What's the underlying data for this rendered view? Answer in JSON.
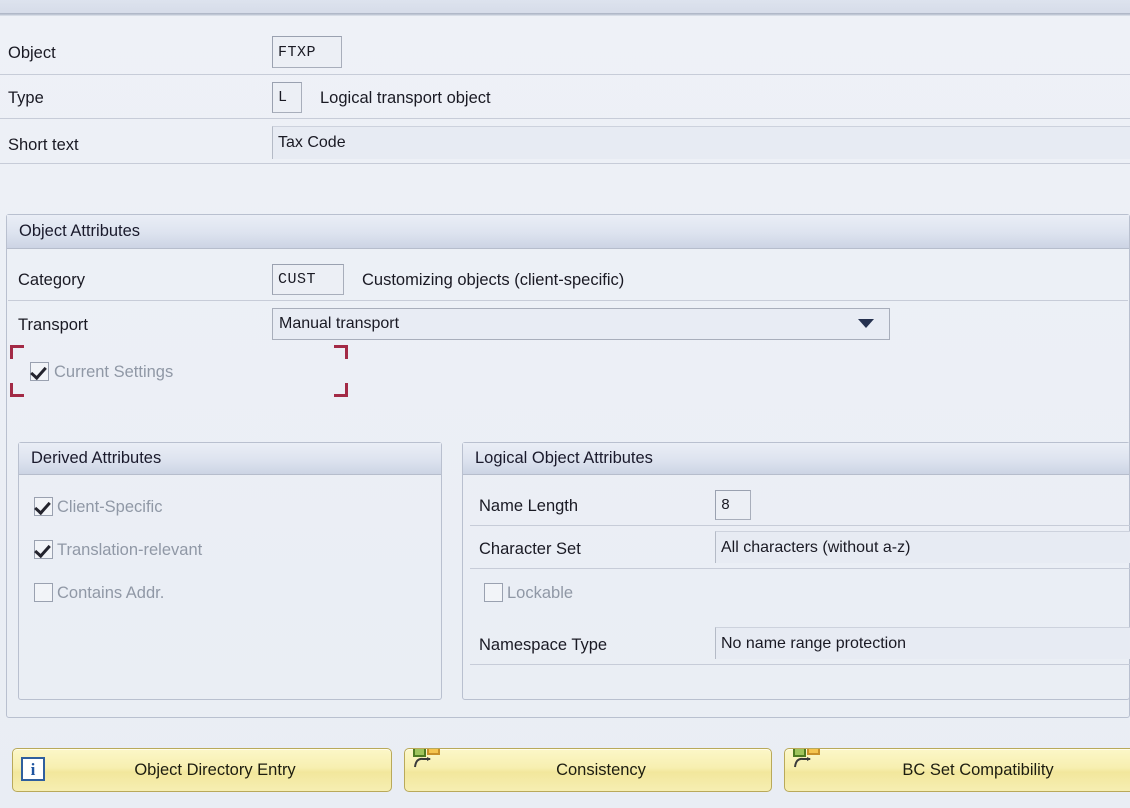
{
  "header": {
    "fields": [
      {
        "label": "Object",
        "value": "FTXP",
        "desc": ""
      },
      {
        "label": "Type",
        "value": "L",
        "desc": "Logical transport object"
      },
      {
        "label": "Short text",
        "value": "Tax Code",
        "desc": ""
      }
    ]
  },
  "object_attributes": {
    "title": "Object Attributes",
    "category": {
      "label": "Category",
      "value": "CUST",
      "description": "Customizing objects (client-specific)"
    },
    "transport": {
      "label": "Transport",
      "selected": "Manual transport",
      "options": [
        "Manual transport"
      ],
      "dropdown_icon": "chevron-down-icon"
    },
    "current_settings": {
      "label": "Current Settings",
      "checked": true,
      "enabled": false,
      "focused": true,
      "focus_color": "#a32a46"
    }
  },
  "derived_attributes": {
    "title": "Derived Attributes",
    "checkboxes": [
      {
        "label": "Client-Specific",
        "checked": true,
        "enabled": false
      },
      {
        "label": "Translation-relevant",
        "checked": true,
        "enabled": false
      },
      {
        "label": "Contains Addr.",
        "checked": false,
        "enabled": false
      }
    ]
  },
  "logical_object_attributes": {
    "title": "Logical Object Attributes",
    "name_length": {
      "label": "Name Length",
      "value": "8"
    },
    "character_set": {
      "label": "Character Set",
      "value": "All characters (without a-z)"
    },
    "lockable": {
      "label": "Lockable",
      "checked": false,
      "enabled": false
    },
    "namespace_type": {
      "label": "Namespace Type",
      "value": "No name range protection"
    }
  },
  "buttons": [
    {
      "label": "Object Directory Entry",
      "icon": "info-icon"
    },
    {
      "label": "Consistency",
      "icon": "compare-icon"
    },
    {
      "label": "BC Set Compatibility",
      "icon": "compare-icon"
    }
  ],
  "colors": {
    "background": "#e9edf4",
    "button_face": "#f7efb0",
    "focus_red": "#a32a46",
    "dropdown_arrow": "#25314f"
  }
}
